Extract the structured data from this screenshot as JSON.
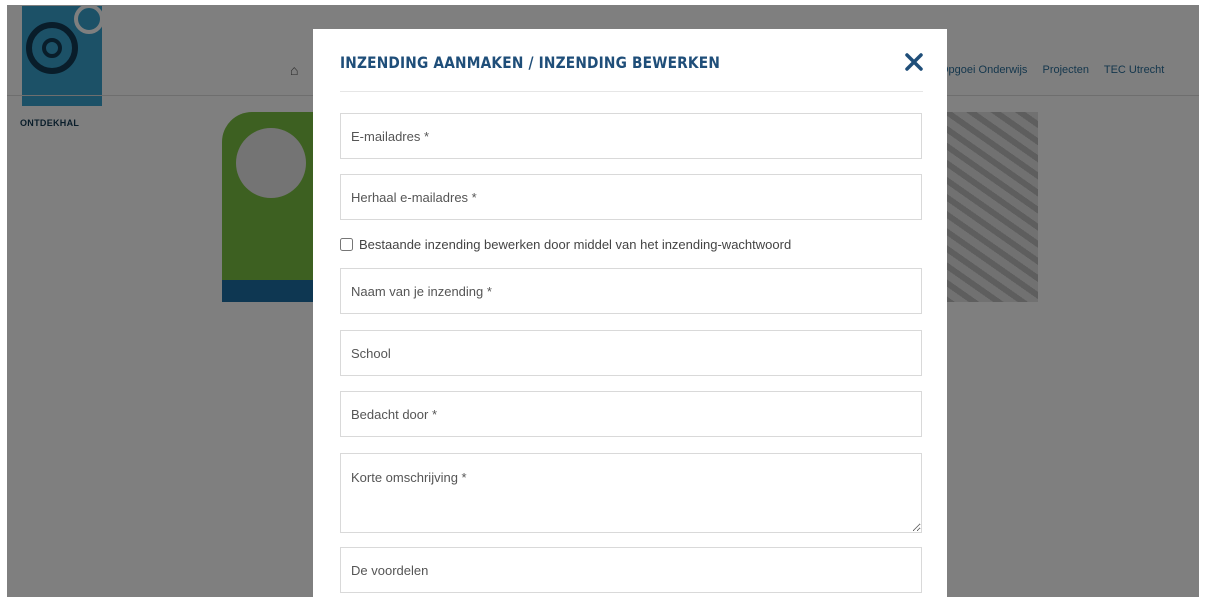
{
  "background": {
    "logo_text": "ONTDEKHAL",
    "nav_items": [
      "Opgoei Onderwijs",
      "Projecten",
      "TEC Utrecht"
    ]
  },
  "modal": {
    "title": "INZENDING AANMAKEN / INZENDING BEWERKEN",
    "close_icon": "close-x",
    "email_placeholder": "E-mailadres *",
    "email_repeat_placeholder": "Herhaal e-mailadres *",
    "edit_checkbox_label": "Bestaande inzending bewerken door middel van het inzending-wachtwoord",
    "edit_checkbox_checked": false,
    "name_placeholder": "Naam van je inzending *",
    "school_placeholder": "School",
    "author_placeholder": "Bedacht door *",
    "description_placeholder": "Korte omschrijving *",
    "benefits_placeholder": "De voordelen"
  },
  "colors": {
    "title": "#1f4e79",
    "overlay": "rgba(0,0,0,0.5)"
  }
}
